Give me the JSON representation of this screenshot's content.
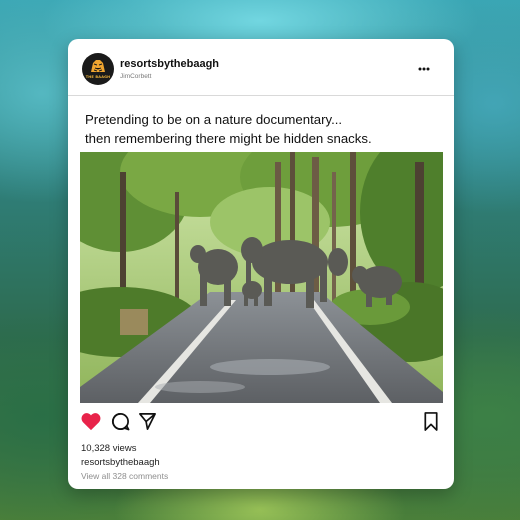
{
  "post": {
    "account": {
      "username": "resortsbythebaagh",
      "location": "JimCorbett",
      "avatar_text": "THE BAAGH",
      "avatar_icon": "tiger-logo"
    },
    "caption_line1": "Pretending to be on a nature documentary...",
    "caption_line2": "then remembering there might be hidden snacks.",
    "media": {
      "icon": "photo-elephants-on-forest-road"
    },
    "actions": {
      "like_icon": "heart-icon",
      "comment_icon": "comment-icon",
      "share_icon": "send-icon",
      "save_icon": "bookmark-icon",
      "more_icon": "more-icon"
    },
    "views": "10,328 views",
    "caption_username": "resortsbythebaagh",
    "comments_link": "View all 328 comments"
  },
  "colors": {
    "like": "#e8234a",
    "text": "#111111",
    "muted": "#8e8e8e"
  }
}
